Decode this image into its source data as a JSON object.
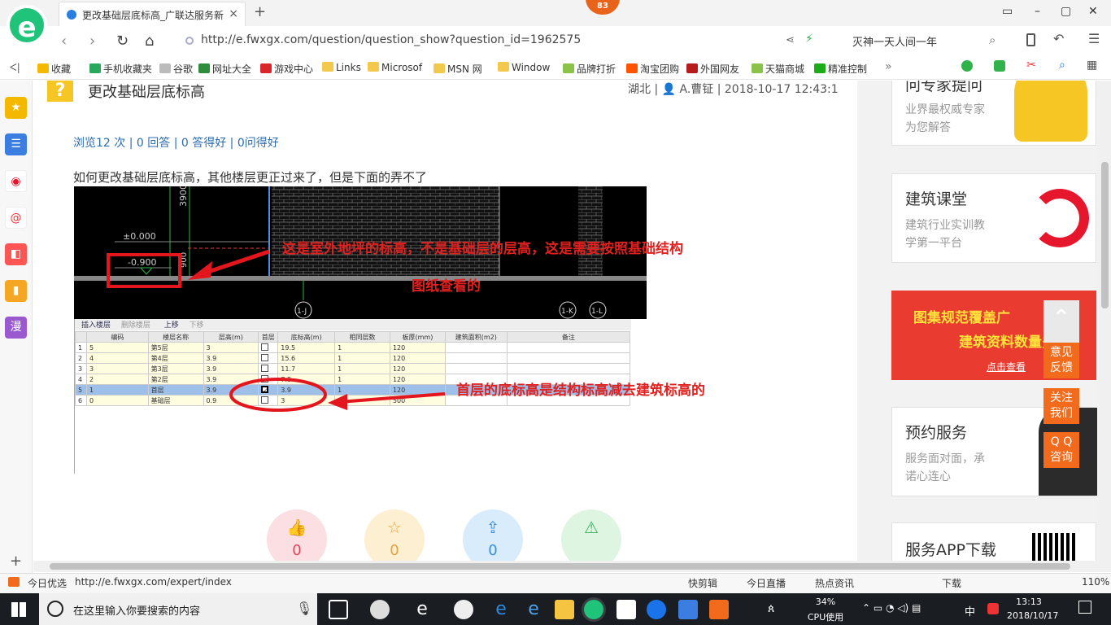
{
  "browser": {
    "logo": "e",
    "tab_title": "更改基础层底标高_广联达服务新",
    "tab_close": "×",
    "new_tab": "+",
    "badge": "83",
    "url": "http://e.fwxgx.com/question/question_show?question_id=1962575",
    "search_text": "灭神一天人间一年",
    "window_controls": [
      "▭",
      "–",
      "▢",
      "✕"
    ],
    "nav": {
      "back": "‹",
      "forward": "›",
      "reload": "↻",
      "home": "⌂",
      "sidebar_toggle": "ᐸ|"
    }
  },
  "favorites": [
    {
      "label": "收藏",
      "color": "#f5b800"
    },
    {
      "label": "手机收藏夹",
      "color": "#27a85a"
    },
    {
      "label": "谷歌",
      "color": "#bbbbbb"
    },
    {
      "label": "网址大全",
      "color": "#2d8d3c"
    },
    {
      "label": "游戏中心",
      "color": "#d9262b"
    },
    {
      "label": "Links",
      "color": "#f2c94c"
    },
    {
      "label": "Microsof",
      "color": "#f2c94c"
    },
    {
      "label": "MSN 网",
      "color": "#f2c94c"
    },
    {
      "label": "Window",
      "color": "#f2c94c"
    },
    {
      "label": "品牌打折",
      "color": "#8bc34a"
    },
    {
      "label": "淘宝团购",
      "color": "#ff5500"
    },
    {
      "label": "外国网友",
      "color": "#b71c1c"
    },
    {
      "label": "天猫商城",
      "color": "#8bc34a"
    },
    {
      "label": "精准控制",
      "color": "#1aad19"
    }
  ],
  "question": {
    "title": "更改基础层底标高",
    "icon": "?",
    "meta": "湖北 | 👤 A.曹钲 | 2018-10-17 12:43:1",
    "stats": "浏览12 次 | 0 回答 | 0 答得好 | 0问得好",
    "body": "如何更改基础层底标高，其他楼层更正过来了，但是下面的弄不了",
    "annotation1_line1": "这是室外地坪的标高，不是基础层的层高，这是需要按照基础结构",
    "annotation1_line2": "图纸查看的",
    "annotation2": "首层的底标高是结构标高减去建筑标高的"
  },
  "cad": {
    "label_3900": "3900",
    "label_pm0": "±0.000",
    "label_m0900": "-0.900",
    "label_900": "900",
    "axis_labels": [
      "1-J",
      "1-K",
      "1-L"
    ]
  },
  "grid": {
    "toolbar": [
      "插入楼层",
      "删除楼层",
      "上移",
      "下移"
    ],
    "headers": [
      "",
      "编码",
      "楼层名称",
      "层高(m)",
      "首层",
      "底标高(m)",
      "相同层数",
      "板厚(mm)",
      "建筑面积(m2)",
      "备注"
    ],
    "rows": [
      {
        "num": "1",
        "code": "5",
        "name": "第5层",
        "height": "3",
        "first": false,
        "elev": "19.5",
        "same": "1",
        "thick": "120"
      },
      {
        "num": "2",
        "code": "4",
        "name": "第4层",
        "height": "3.9",
        "first": false,
        "elev": "15.6",
        "same": "1",
        "thick": "120"
      },
      {
        "num": "3",
        "code": "3",
        "name": "第3层",
        "height": "3.9",
        "first": false,
        "elev": "11.7",
        "same": "1",
        "thick": "120"
      },
      {
        "num": "4",
        "code": "2",
        "name": "第2层",
        "height": "3.9",
        "first": false,
        "elev": "7.8",
        "same": "1",
        "thick": "120"
      },
      {
        "num": "5",
        "code": "1",
        "name": "首层",
        "height": "3.9",
        "first": true,
        "elev": "3.9",
        "same": "1",
        "thick": "120"
      },
      {
        "num": "6",
        "code": "0",
        "name": "基础层",
        "height": "0.9",
        "first": false,
        "elev": "3",
        "same": "",
        "thick": "500"
      }
    ]
  },
  "actions": [
    {
      "icon": "👍",
      "count": "0",
      "bg": "#fbdfe3",
      "color": "#e2455d"
    },
    {
      "icon": "☆",
      "count": "0",
      "bg": "#fdf0d2",
      "color": "#e8a23a"
    },
    {
      "icon": "⇪",
      "count": "0",
      "bg": "#d9ecfb",
      "color": "#3a8fd8"
    },
    {
      "icon": "⚠",
      "count": "",
      "bg": "#def5e2",
      "color": "#3ab05a"
    }
  ],
  "sidebar_cards": [
    {
      "title": "问专家提问",
      "sub1": "业界最权威专家",
      "sub2": "为您解答"
    },
    {
      "title": "建筑课堂",
      "sub1": "建筑行业实训教",
      "sub2": "学第一平台"
    },
    {
      "title": "图集规范覆盖广",
      "sub1": "建筑资料数量多",
      "sub2": "点击查看"
    },
    {
      "title": "预约服务",
      "sub1": "服务面对面，承",
      "sub2": "诺心连心"
    },
    {
      "title": "服务APP下载",
      "sub1": "",
      "sub2": ""
    }
  ],
  "float_buttons": {
    "feedback": "意见\n反馈",
    "contact": "关注\n我们",
    "qq": "Q Q\n咨询"
  },
  "statusbar": {
    "today": "今日优选",
    "link": "http://e.fwxgx.com/expert/index",
    "items": [
      "快剪辑",
      "今日直播",
      "热点资讯",
      "下载"
    ],
    "zoom": "110%"
  },
  "taskbar": {
    "search_placeholder": "在这里输入你要搜索的内容",
    "cpu_pct": "34%",
    "cpu_label": "CPU使用",
    "time": "13:13",
    "date": "2018/10/17",
    "ime": "中"
  }
}
